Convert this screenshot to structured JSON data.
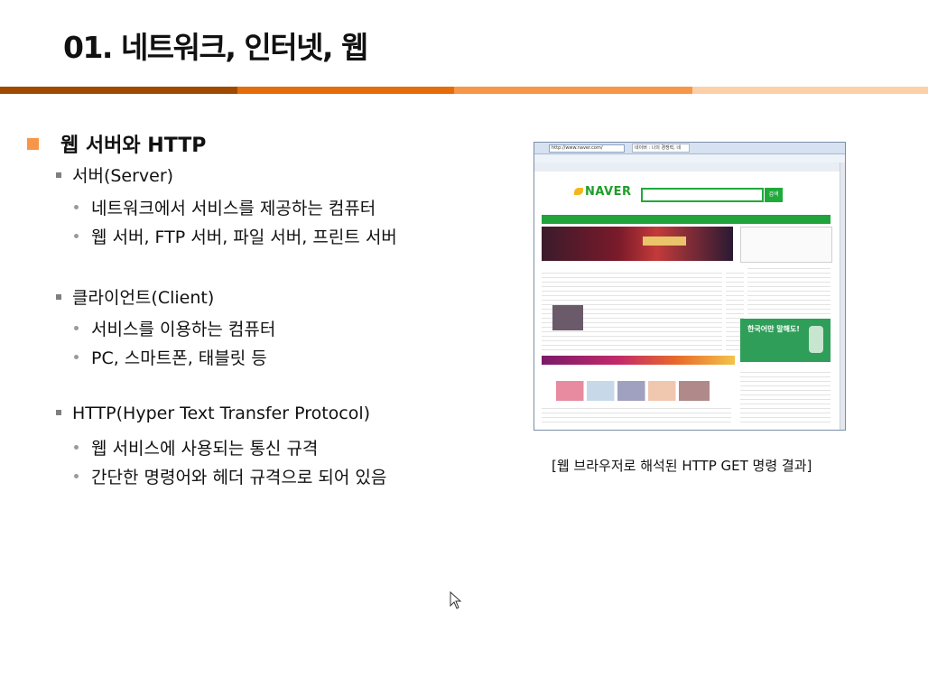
{
  "slide": {
    "title": "01. 네트워크, 인터넷, 웹",
    "bullets": {
      "l1": "웹 서버와 HTTP",
      "server": "서버(Server)",
      "server_items": [
        "네트워크에서 서비스를 제공하는 컴퓨터",
        "웹 서버, FTP 서버, 파일 서버, 프린트 서버"
      ],
      "client": "클라이언트(Client)",
      "client_items": [
        "서비스를 이용하는 컴퓨터",
        "PC, 스마트폰, 태블릿 등"
      ],
      "http": "HTTP(Hyper Text Transfer Protocol)",
      "http_items": [
        "웹 서비스에 사용되는 통신 규격",
        "간단한 명령어와 헤더 규격으로 되어 있음"
      ]
    },
    "caption": "[웹 브라우저로 해석된 HTTP GET 명령 결과]"
  },
  "screenshot": {
    "address": "http://www.naver.com/",
    "tab": "네이버 : 나의 경쟁력, 네",
    "logo": "NAVER",
    "search_button": "검색",
    "ad_text": "한국어만 말해도!"
  },
  "colors": {
    "accent": "#f79646",
    "bar_dark": "#a04a00",
    "bar_orange": "#e46c0a",
    "bar_light": "#fbd0a8",
    "naver_green": "#1faa3a"
  },
  "icons": {
    "l1_bullet": "orange-square-bullet",
    "l2_bullet": "gray-square-bullet",
    "l3_bullet": "gray-dot-bullet",
    "cursor": "mouse-pointer-icon"
  }
}
